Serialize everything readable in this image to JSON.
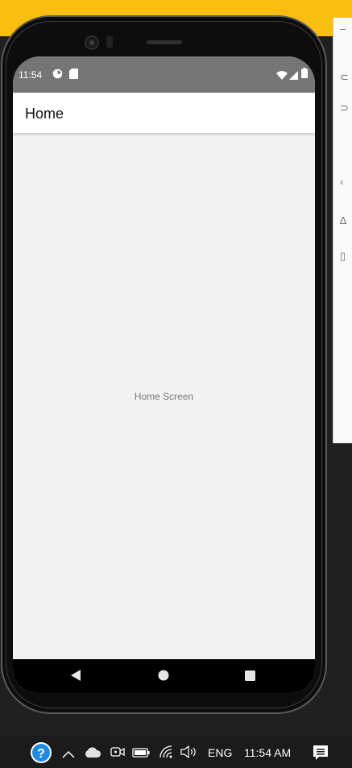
{
  "phone": {
    "status_time": "11:54",
    "app_title": "Home",
    "screen_text": "Home Screen"
  },
  "taskbar": {
    "language": "ENG",
    "clock": "11:54 AM"
  },
  "colors": {
    "desktop_accent": "#f9be0f",
    "status_bar": "#757575",
    "app_bar": "#ffffff",
    "screen_bg": "#f2f2f2",
    "taskbar_bg": "#1b1b1b",
    "help_icon": "#1e88e5"
  },
  "icons": [
    "data-saver-icon",
    "sd-card-icon",
    "wifi-icon",
    "cell-signal-icon",
    "battery-icon",
    "back-icon",
    "home-icon",
    "recents-icon",
    "help-icon",
    "chevron-up-icon",
    "cloud-icon",
    "meet-now-icon",
    "taskbar-battery-icon",
    "network-icon",
    "volume-icon",
    "notification-icon"
  ]
}
